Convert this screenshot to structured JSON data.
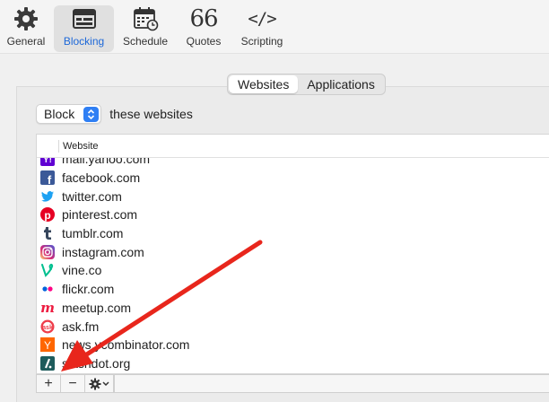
{
  "toolbar": {
    "items": [
      {
        "label": "General",
        "icon": "gear-icon",
        "active": false
      },
      {
        "label": "Blocking",
        "icon": "window-icon",
        "active": true
      },
      {
        "label": "Schedule",
        "icon": "calendar-icon",
        "active": false
      },
      {
        "label": "Quotes",
        "icon": "quote-icon",
        "glyph": "66",
        "active": false
      },
      {
        "label": "Scripting",
        "icon": "code-icon",
        "glyph": "</>",
        "active": false
      }
    ],
    "active_color": "#1d68d8"
  },
  "segmented": {
    "options": [
      "Websites",
      "Applications"
    ],
    "selected": "Websites"
  },
  "block_control": {
    "value": "Block",
    "suffix": "these websites"
  },
  "table": {
    "column_header": "Website",
    "rows": [
      {
        "site": "mail.yahoo.com",
        "icon": "yahoo-icon"
      },
      {
        "site": "facebook.com",
        "icon": "facebook-icon"
      },
      {
        "site": "twitter.com",
        "icon": "twitter-icon"
      },
      {
        "site": "pinterest.com",
        "icon": "pinterest-icon"
      },
      {
        "site": "tumblr.com",
        "icon": "tumblr-icon"
      },
      {
        "site": "instagram.com",
        "icon": "instagram-icon"
      },
      {
        "site": "vine.co",
        "icon": "vine-icon"
      },
      {
        "site": "flickr.com",
        "icon": "flickr-icon"
      },
      {
        "site": "meetup.com",
        "icon": "meetup-icon"
      },
      {
        "site": "ask.fm",
        "icon": "askfm-icon"
      },
      {
        "site": "news.ycombinator.com",
        "icon": "ycombinator-icon"
      },
      {
        "site": "slashdot.org",
        "icon": "slashdot-icon"
      }
    ]
  },
  "bottom_buttons": {
    "add": "+",
    "remove": "−"
  },
  "colors": {
    "accent": "#2f7ff4",
    "annotation_arrow": "#e8261c"
  }
}
